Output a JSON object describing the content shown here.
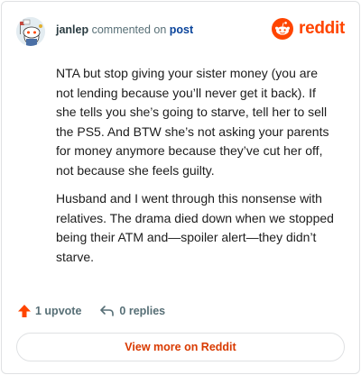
{
  "header": {
    "author": "janlep",
    "action_text": "commented on",
    "post_link": "post",
    "logo_text": "reddit",
    "icons": {
      "avatar": "snoo-avatar",
      "logo": "reddit-logo-icon"
    }
  },
  "comment": {
    "paragraphs": [
      "NTA but stop giving your sister money (you are not lending because you’ll never get it back). If she tells you she’s going to starve, tell her to sell the PS5. And BTW she’s not asking your parents for money anymore because they’ve cut her off, not because she feels guilty.",
      "Husband and I went through this nonsense with relatives. The drama died down when we stopped being their ATM and—spoiler alert—they didn’t starve."
    ]
  },
  "actions": {
    "upvote_label": "1 upvote",
    "replies_label": "0 replies",
    "icons": {
      "upvote": "upvote-arrow-icon",
      "reply": "reply-arrow-icon"
    }
  },
  "footer": {
    "view_more_label": "View more on Reddit"
  },
  "colors": {
    "brand": "#ff4500",
    "link": "#0a449b",
    "view_more": "#d93a00",
    "muted": "#576f76",
    "border": "#dfe1e3"
  }
}
